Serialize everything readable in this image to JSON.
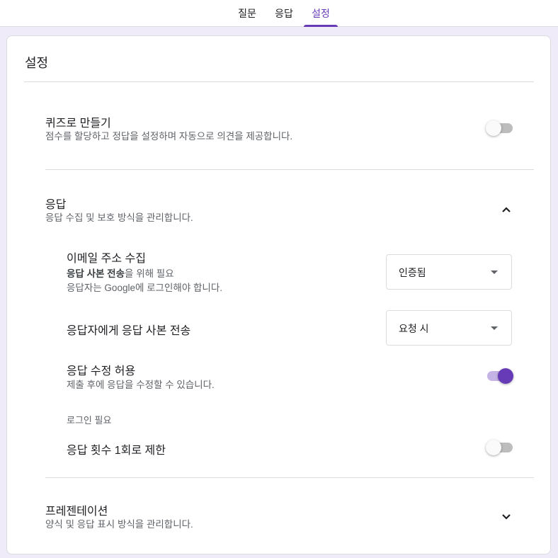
{
  "tabs": [
    {
      "label": "질문"
    },
    {
      "label": "응답"
    },
    {
      "label": "설정"
    }
  ],
  "settings": {
    "title": "설정",
    "quiz": {
      "title": "퀴즈로 만들기",
      "description": "점수를 할당하고 정답을 설정하며 자동으로 의견을 제공합니다.",
      "enabled": false
    },
    "responses": {
      "title": "응답",
      "description": "응답 수집 및 보호 방식을 관리합니다.",
      "expanded": true,
      "collect_email": {
        "title": "이메일 주소 수집",
        "note_bold": "응답 사본 전송",
        "note_rest": "을 위해 필요",
        "note2": "응답자는 Google에 로그인해야 합니다.",
        "selected": "인증됨"
      },
      "send_copy": {
        "title": "응답자에게 응답 사본 전송",
        "selected": "요청 시"
      },
      "allow_edit": {
        "title": "응답 수정 허용",
        "description": "제출 후에 응답을 수정할 수 있습니다.",
        "enabled": true
      },
      "login_required_label": "로그인 필요",
      "limit_one": {
        "title": "응답 횟수 1회로 제한",
        "enabled": false
      }
    },
    "presentation": {
      "title": "프레젠테이션",
      "description": "양식 및 응답 표시 방식을 관리합니다.",
      "expanded": false
    }
  },
  "colors": {
    "accent": "#673ab7",
    "page_bg": "#f0ebf8"
  }
}
